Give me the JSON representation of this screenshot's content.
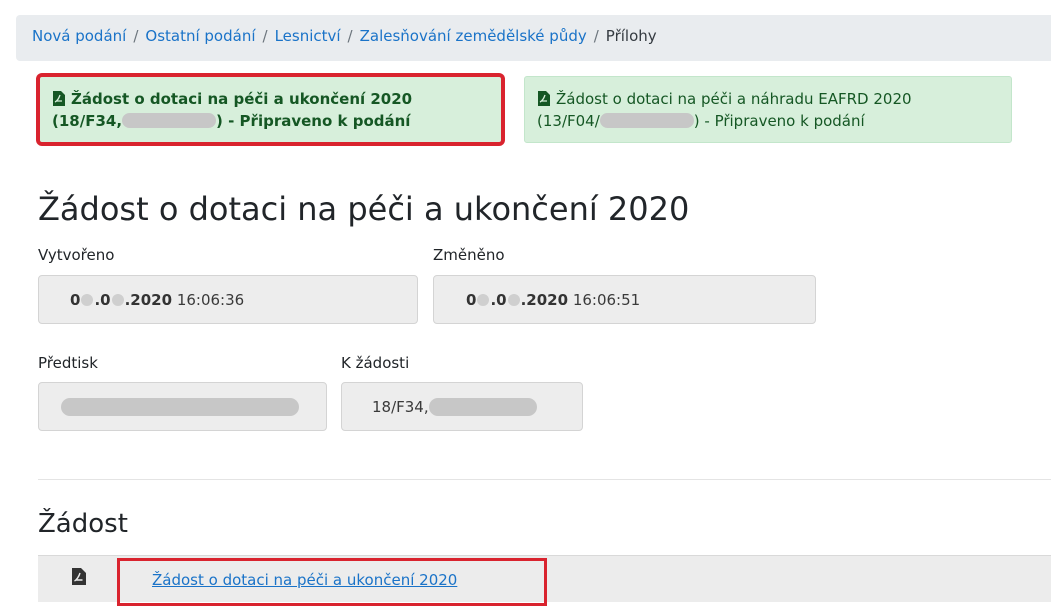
{
  "breadcrumb": {
    "items": [
      "Nová podání",
      "Ostatní podání",
      "Lesnictví",
      "Zalesňování zemědělské půdy"
    ],
    "separator": "/",
    "current": "Přílohy"
  },
  "tiles": [
    {
      "line1": "Žádost o dotaci na péči a ukončení 2020",
      "line2_prefix": "(18/F34,",
      "line2_suffix": ") - Připraveno k podání",
      "selected": true
    },
    {
      "line1": "Žádost o dotaci na péči a náhradu EAFRD 2020",
      "line2_prefix": "(13/F04/",
      "line2_suffix": ") - Připraveno k podání",
      "selected": false
    }
  ],
  "main": {
    "title": "Žádost o dotaci na péči a ukončení 2020",
    "created_label": "Vytvořeno",
    "created_date_start": "0",
    "created_date_mid": ".0",
    "created_date_end": ".2020",
    "created_time": "16:06:36",
    "changed_label": "Změněno",
    "changed_date_start": "0",
    "changed_date_mid": ".0",
    "changed_date_end": ".2020",
    "changed_time": "16:06:51",
    "predtisk_label": "Předtisk",
    "k_zadosti_label": "K žádosti",
    "k_zadosti_value": "18/F34,"
  },
  "section": {
    "title": "Žádost",
    "document_link": "Žádost o dotaci na péči a ukončení 2020",
    "document_icon": "pdf-icon"
  },
  "colors": {
    "link": "#1a73c8",
    "highlight": "#d9232e",
    "tile_bg": "#d7efdb",
    "tile_text": "#155724"
  }
}
